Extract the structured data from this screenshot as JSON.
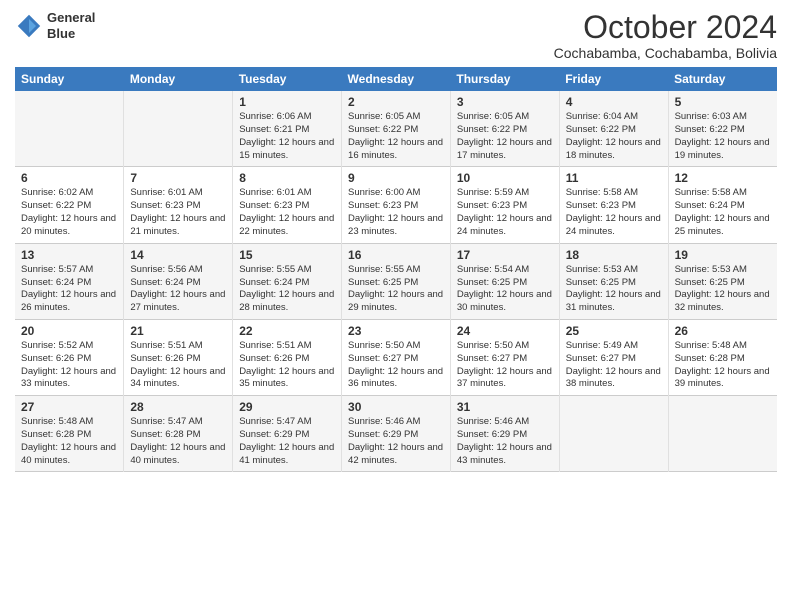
{
  "header": {
    "logo_line1": "General",
    "logo_line2": "Blue",
    "title": "October 2024",
    "subtitle": "Cochabamba, Cochabamba, Bolivia"
  },
  "days_of_week": [
    "Sunday",
    "Monday",
    "Tuesday",
    "Wednesday",
    "Thursday",
    "Friday",
    "Saturday"
  ],
  "weeks": [
    [
      {
        "day": "",
        "info": ""
      },
      {
        "day": "",
        "info": ""
      },
      {
        "day": "1",
        "info": "Sunrise: 6:06 AM\nSunset: 6:21 PM\nDaylight: 12 hours and 15 minutes."
      },
      {
        "day": "2",
        "info": "Sunrise: 6:05 AM\nSunset: 6:22 PM\nDaylight: 12 hours and 16 minutes."
      },
      {
        "day": "3",
        "info": "Sunrise: 6:05 AM\nSunset: 6:22 PM\nDaylight: 12 hours and 17 minutes."
      },
      {
        "day": "4",
        "info": "Sunrise: 6:04 AM\nSunset: 6:22 PM\nDaylight: 12 hours and 18 minutes."
      },
      {
        "day": "5",
        "info": "Sunrise: 6:03 AM\nSunset: 6:22 PM\nDaylight: 12 hours and 19 minutes."
      }
    ],
    [
      {
        "day": "6",
        "info": "Sunrise: 6:02 AM\nSunset: 6:22 PM\nDaylight: 12 hours and 20 minutes."
      },
      {
        "day": "7",
        "info": "Sunrise: 6:01 AM\nSunset: 6:23 PM\nDaylight: 12 hours and 21 minutes."
      },
      {
        "day": "8",
        "info": "Sunrise: 6:01 AM\nSunset: 6:23 PM\nDaylight: 12 hours and 22 minutes."
      },
      {
        "day": "9",
        "info": "Sunrise: 6:00 AM\nSunset: 6:23 PM\nDaylight: 12 hours and 23 minutes."
      },
      {
        "day": "10",
        "info": "Sunrise: 5:59 AM\nSunset: 6:23 PM\nDaylight: 12 hours and 24 minutes."
      },
      {
        "day": "11",
        "info": "Sunrise: 5:58 AM\nSunset: 6:23 PM\nDaylight: 12 hours and 24 minutes."
      },
      {
        "day": "12",
        "info": "Sunrise: 5:58 AM\nSunset: 6:24 PM\nDaylight: 12 hours and 25 minutes."
      }
    ],
    [
      {
        "day": "13",
        "info": "Sunrise: 5:57 AM\nSunset: 6:24 PM\nDaylight: 12 hours and 26 minutes."
      },
      {
        "day": "14",
        "info": "Sunrise: 5:56 AM\nSunset: 6:24 PM\nDaylight: 12 hours and 27 minutes."
      },
      {
        "day": "15",
        "info": "Sunrise: 5:55 AM\nSunset: 6:24 PM\nDaylight: 12 hours and 28 minutes."
      },
      {
        "day": "16",
        "info": "Sunrise: 5:55 AM\nSunset: 6:25 PM\nDaylight: 12 hours and 29 minutes."
      },
      {
        "day": "17",
        "info": "Sunrise: 5:54 AM\nSunset: 6:25 PM\nDaylight: 12 hours and 30 minutes."
      },
      {
        "day": "18",
        "info": "Sunrise: 5:53 AM\nSunset: 6:25 PM\nDaylight: 12 hours and 31 minutes."
      },
      {
        "day": "19",
        "info": "Sunrise: 5:53 AM\nSunset: 6:25 PM\nDaylight: 12 hours and 32 minutes."
      }
    ],
    [
      {
        "day": "20",
        "info": "Sunrise: 5:52 AM\nSunset: 6:26 PM\nDaylight: 12 hours and 33 minutes."
      },
      {
        "day": "21",
        "info": "Sunrise: 5:51 AM\nSunset: 6:26 PM\nDaylight: 12 hours and 34 minutes."
      },
      {
        "day": "22",
        "info": "Sunrise: 5:51 AM\nSunset: 6:26 PM\nDaylight: 12 hours and 35 minutes."
      },
      {
        "day": "23",
        "info": "Sunrise: 5:50 AM\nSunset: 6:27 PM\nDaylight: 12 hours and 36 minutes."
      },
      {
        "day": "24",
        "info": "Sunrise: 5:50 AM\nSunset: 6:27 PM\nDaylight: 12 hours and 37 minutes."
      },
      {
        "day": "25",
        "info": "Sunrise: 5:49 AM\nSunset: 6:27 PM\nDaylight: 12 hours and 38 minutes."
      },
      {
        "day": "26",
        "info": "Sunrise: 5:48 AM\nSunset: 6:28 PM\nDaylight: 12 hours and 39 minutes."
      }
    ],
    [
      {
        "day": "27",
        "info": "Sunrise: 5:48 AM\nSunset: 6:28 PM\nDaylight: 12 hours and 40 minutes."
      },
      {
        "day": "28",
        "info": "Sunrise: 5:47 AM\nSunset: 6:28 PM\nDaylight: 12 hours and 40 minutes."
      },
      {
        "day": "29",
        "info": "Sunrise: 5:47 AM\nSunset: 6:29 PM\nDaylight: 12 hours and 41 minutes."
      },
      {
        "day": "30",
        "info": "Sunrise: 5:46 AM\nSunset: 6:29 PM\nDaylight: 12 hours and 42 minutes."
      },
      {
        "day": "31",
        "info": "Sunrise: 5:46 AM\nSunset: 6:29 PM\nDaylight: 12 hours and 43 minutes."
      },
      {
        "day": "",
        "info": ""
      },
      {
        "day": "",
        "info": ""
      }
    ]
  ]
}
